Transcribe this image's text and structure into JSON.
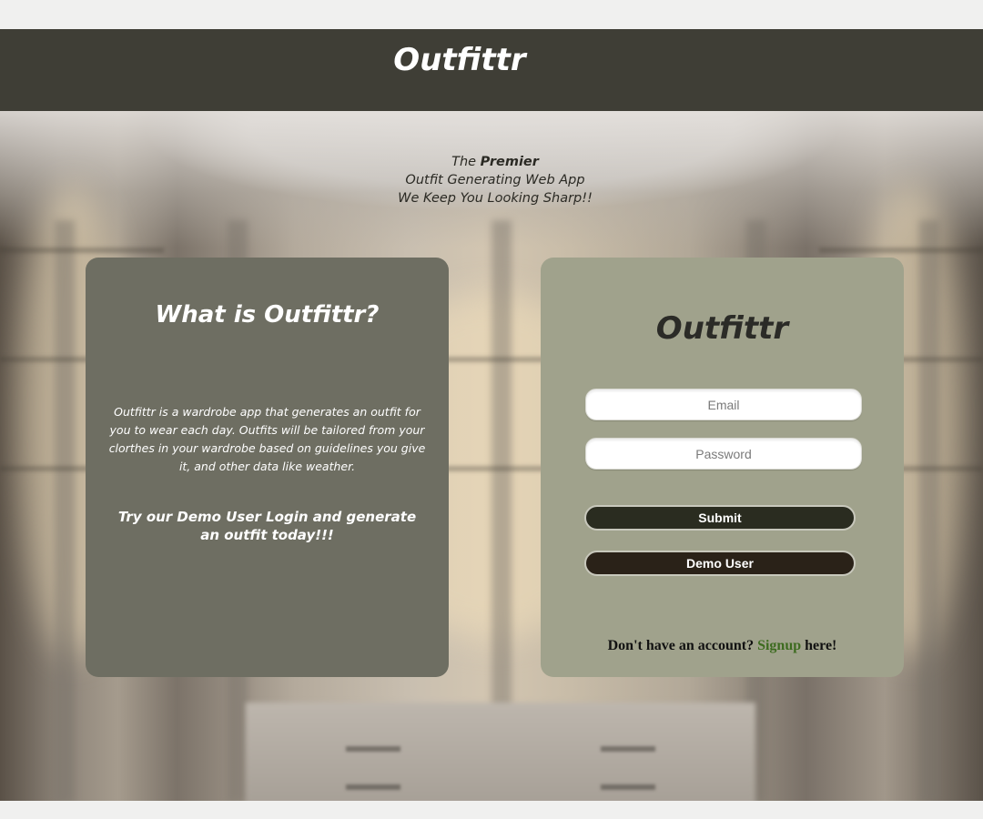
{
  "header": {
    "title": "Outfittr"
  },
  "tagline": {
    "line1_prefix": "The ",
    "line1_emphasis": "Premier",
    "line2": "Outfit Generating Web App",
    "line3_prefix": "We Keep You Looking ",
    "line3_emphasis": "Sharp!!"
  },
  "about_card": {
    "heading": "What is Outfittr?",
    "description": "Outfittr is a wardrobe app that generates an outfit for you to wear each day. Outfits will be tailored from your clorthes in your wardrobe based on guidelines you give it, and other data like weather.",
    "cta": "Try our Demo User Login and generate an outfit today!!!"
  },
  "login_card": {
    "brand": "Outfittr",
    "email_placeholder": "Email",
    "email_value": "",
    "password_placeholder": "Password",
    "password_value": "",
    "submit_label": "Submit",
    "demo_label": "Demo User",
    "signup_prefix": "Don't have an account? ",
    "signup_link": "Signup",
    "signup_suffix": " here!"
  },
  "colors": {
    "header_bg": "#3f3e36",
    "about_card_bg": "#6e6e62",
    "login_card_bg": "#a0a28c",
    "submit_bg": "#2a2c20",
    "demo_bg": "#2a2218",
    "signup_link": "#3d6b1f"
  }
}
